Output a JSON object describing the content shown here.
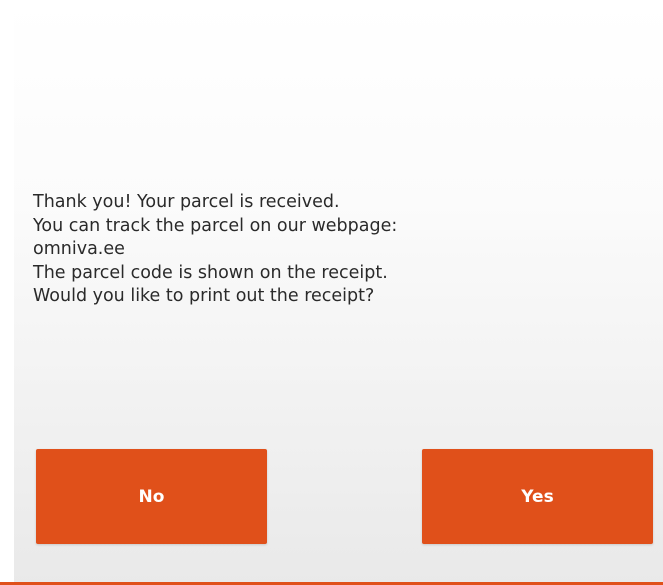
{
  "message": {
    "lines": [
      "Thank you! Your parcel is received.",
      "You can track the parcel on our webpage:",
      "omniva.ee",
      "The parcel code is shown on the receipt.",
      "Would you like to print out the receipt?"
    ]
  },
  "buttons": {
    "no_label": "No",
    "yes_label": "Yes"
  },
  "colors": {
    "accent": "#e0501a",
    "text": "#2a2a2a",
    "button_text": "#ffffff"
  }
}
